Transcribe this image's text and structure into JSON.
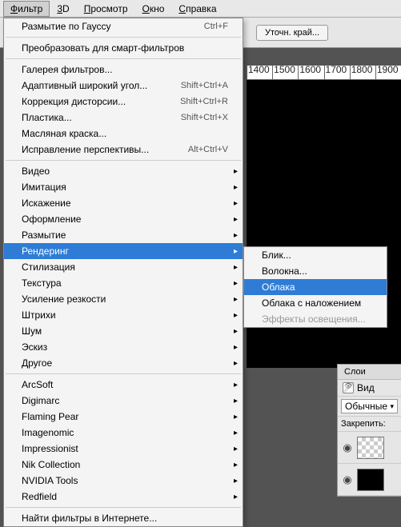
{
  "menubar": {
    "items": [
      "Фильтр",
      "3D",
      "Просмотр",
      "Окно",
      "Справка"
    ],
    "underline": [
      "Ф",
      "3",
      "П",
      "О",
      "С"
    ]
  },
  "toolbar": {
    "refine_edge": "Уточн. край..."
  },
  "ruler": [
    "1400",
    "1500",
    "1600",
    "1700",
    "1800",
    "1900"
  ],
  "menu": {
    "last_filter": "Размытие по Гауссу",
    "last_filter_sc": "Ctrl+F",
    "convert_smart": "Преобразовать для смарт-фильтров",
    "gallery": "Галерея фильтров...",
    "adaptive": "Адаптивный широкий угол...",
    "adaptive_sc": "Shift+Ctrl+A",
    "lens": "Коррекция дисторсии...",
    "lens_sc": "Shift+Ctrl+R",
    "liquify": "Пластика...",
    "liquify_sc": "Shift+Ctrl+X",
    "oil": "Масляная краска...",
    "vanish": "Исправление перспективы...",
    "vanish_sc": "Alt+Ctrl+V",
    "groups": [
      "Видео",
      "Имитация",
      "Искажение",
      "Оформление",
      "Размытие",
      "Рендеринг",
      "Стилизация",
      "Текстура",
      "Усиление резкости",
      "Штрихи",
      "Шум",
      "Эскиз",
      "Другое"
    ],
    "plugins": [
      "ArcSoft",
      "Digimarc",
      "Flaming Pear",
      "Imagenomic",
      "Impressionist",
      "Nik Collection",
      "NVIDIA Tools",
      "Redfield"
    ],
    "browse": "Найти фильтры в Интернете..."
  },
  "submenu": {
    "items": [
      "Блик...",
      "Волокна...",
      "Облака",
      "Облака с наложением",
      "Эффекты освещения..."
    ],
    "highlighted": 2,
    "disabled": [
      4
    ]
  },
  "panel": {
    "tab": "Слои",
    "kind": "Вид",
    "mode": "Обычные",
    "lock": "Закрепить:"
  }
}
